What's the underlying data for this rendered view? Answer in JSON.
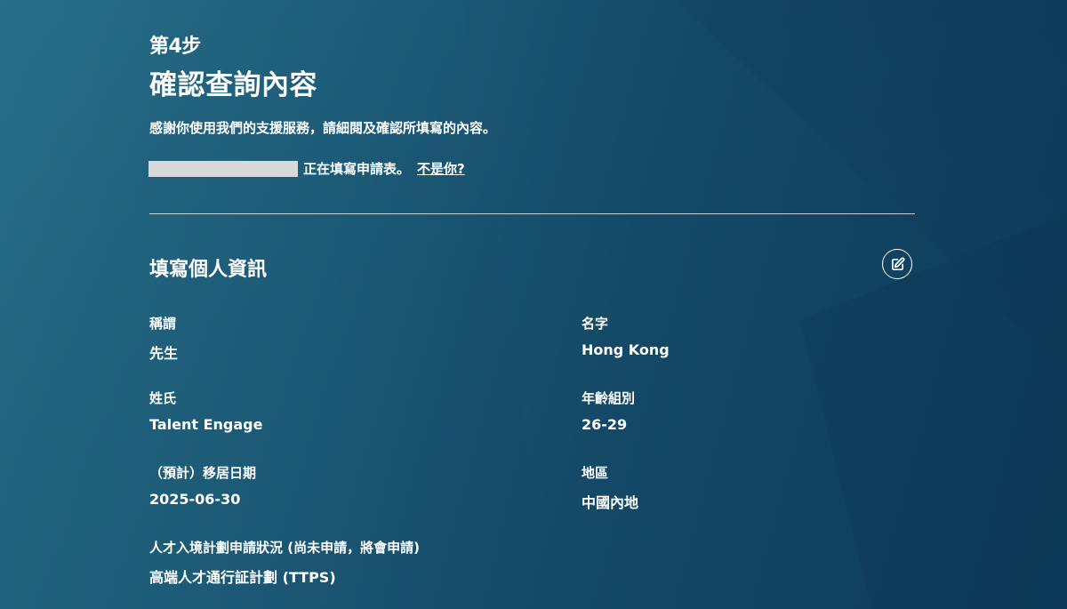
{
  "header": {
    "step_label": "第4步",
    "title": "確認查詢內容",
    "intro": "感謝你使用我們的支援服務，請細閱及確認所填寫的內容。"
  },
  "user_line": {
    "filling_text": "正在填寫申請表。",
    "not_you_link": "不是你?"
  },
  "section": {
    "title": "填寫個人資訊",
    "edit_icon": "edit-icon"
  },
  "fields": {
    "salutation": {
      "label": "稱謂",
      "value": "先生"
    },
    "first_name": {
      "label": "名字",
      "value": "Hong Kong"
    },
    "surname": {
      "label": "姓氏",
      "value": "Talent Engage"
    },
    "age_group": {
      "label": "年齡組別",
      "value": "26-29"
    },
    "relocation_date": {
      "label": "（預計）移居日期",
      "value": "2025-06-30"
    },
    "region": {
      "label": "地區",
      "value": "中國內地"
    },
    "talent_scheme": {
      "label": "人才入境計劃申請狀況 (尚未申請，將會申請)",
      "value": "高端人才通行証計劃 (TTPS)"
    }
  },
  "colors": {
    "background_start": "#256b84",
    "background_end": "#0e3b58",
    "text": "#ffffff",
    "redacted_block": "#d9d9d9"
  }
}
